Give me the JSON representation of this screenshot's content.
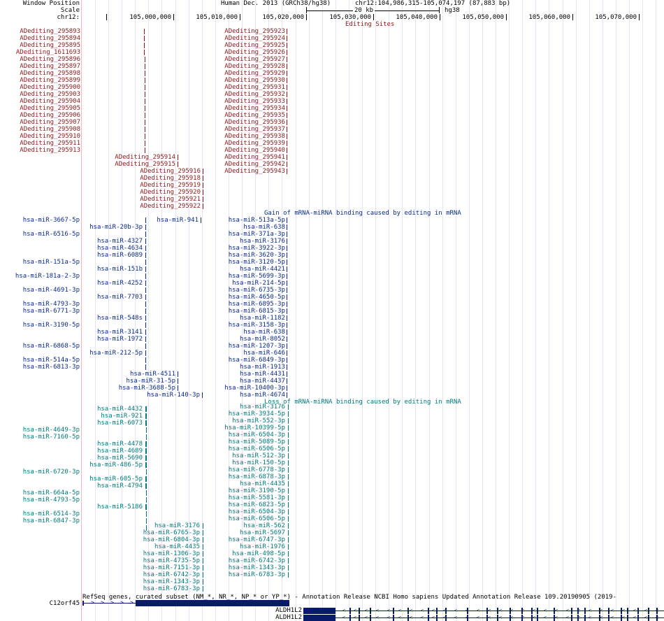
{
  "header": {
    "window_position_label": "Window Position",
    "scale_label": "Scale",
    "chrom_label": "chr12:",
    "assembly": "Human Dec. 2013 (GRCh38/hg38)",
    "position": "chr12:104,986,315-105,074,197 (87,883 bp)",
    "scale_text": "20 kb",
    "scale_db": "hg38",
    "ruler_ticks": [
      "105,000,000",
      "105,010,000",
      "105,020,000",
      "105,030,000",
      "105,040,000",
      "105,050,000",
      "105,060,000",
      "105,070,000"
    ]
  },
  "editing_sites": {
    "track_title": "Editing Sites",
    "left_labels": [
      "ADediting_295893",
      "ADediting_295894",
      "ADediting_295895",
      "ADediting_1611693",
      "ADediting_295896",
      "ADediting_295897",
      "ADediting_295898",
      "ADediting_295899",
      "ADediting_295900",
      "ADediting_295903",
      "ADediting_295904",
      "ADediting_295905",
      "ADediting_295906",
      "ADediting_295907",
      "ADediting_295908",
      "ADediting_295910",
      "ADediting_295911",
      "ADediting_295913"
    ],
    "mid_labels": [
      "ADediting_295914",
      "ADediting_295915",
      "ADediting_295916",
      "ADediting_295918",
      "ADediting_295919",
      "ADediting_295920",
      "ADediting_295921",
      "ADediting_295922"
    ],
    "right_labels": [
      "ADediting_295923",
      "ADediting_295924",
      "ADediting_295925",
      "ADediting_295926",
      "ADediting_295927",
      "ADediting_295928",
      "ADediting_295929",
      "ADediting_295930",
      "ADediting_295931",
      "ADediting_295932",
      "ADediting_295933",
      "ADediting_295934",
      "ADediting_295935",
      "ADediting_295936",
      "ADediting_295937",
      "ADediting_295938",
      "ADediting_295939",
      "ADediting_295940",
      "ADediting_295941",
      "ADediting_295942",
      "ADediting_295943"
    ]
  },
  "gain_track": {
    "track_title": "Gain of mRNA-miRNA binding caused by editing in mRNA",
    "left_labels": [
      "hsa-miR-3667-5p",
      "",
      "hsa-miR-6516-5p",
      "",
      "",
      "",
      "hsa-miR-151a-5p",
      "",
      "hsa-miR-181a-2-3p",
      "",
      "hsa-miR-4691-3p",
      "",
      "hsa-miR-4793-3p",
      "hsa-miR-6771-3p",
      "",
      "hsa-miR-3190-5p",
      "",
      "",
      "hsa-miR-6868-5p",
      "",
      "hsa-miR-514a-5p",
      "hsa-miR-6813-3p"
    ],
    "mid_labels": [
      "hsa-miR-941",
      "hsa-miR-20b-3p",
      "",
      "hsa-miR-4327",
      "hsa-miR-4634",
      "hsa-miR-6089",
      "",
      "hsa-miR-151b",
      "",
      "hsa-miR-4252",
      "",
      "hsa-miR-7703",
      "",
      "",
      "hsa-miR-548s",
      "",
      "hsa-miR-3141",
      "hsa-miR-1972",
      "",
      "hsa-miR-212-5p",
      "",
      "",
      "hsa-miR-4511",
      "hsa-miR-31-5p",
      "hsa-miR-3688-5p",
      "hsa-miR-140-3p"
    ],
    "right_labels": [
      "hsa-miR-513a-5p",
      "hsa-miR-638",
      "hsa-miR-371a-3p",
      "hsa-miR-3176",
      "hsa-miR-3922-3p",
      "hsa-miR-3620-3p",
      "hsa-miR-3120-5p",
      "hsa-miR-4421",
      "hsa-miR-5699-3p",
      "hsa-miR-214-5p",
      "hsa-miR-6735-3p",
      "hsa-miR-4650-5p",
      "hsa-miR-6895-3p",
      "hsa-miR-6815-3p",
      "hsa-miR-1182",
      "hsa-miR-3158-3p",
      "hsa-miR-638",
      "hsa-miR-8052",
      "hsa-miR-1207-3p",
      "hsa-miR-646",
      "hsa-miR-6849-3p",
      "hsa-miR-1913",
      "hsa-miR-4431",
      "hsa-miR-4437",
      "hsa-miR-10400-3p",
      "hsa-miR-4674"
    ]
  },
  "loss_track": {
    "track_title": "Loss of mRNA-miRNA binding caused by editing in mRNA",
    "left_labels": [
      "",
      "",
      "",
      "hsa-miR-4649-3p",
      "hsa-miR-7160-5p",
      "",
      "",
      "",
      "",
      "hsa-miR-6720-3p",
      "",
      "",
      "hsa-miR-664a-5p",
      "hsa-miR-4793-5p",
      "",
      "hsa-miR-6514-3p",
      "hsa-miR-6847-3p"
    ],
    "mid_labels": [
      "hsa-miR-4432",
      "hsa-miR-921",
      "hsa-miR-6073",
      "",
      "",
      "hsa-miR-4478",
      "hsa-miR-4689",
      "hsa-miR-5690",
      "hsa-miR-486-5p",
      "",
      "hsa-miR-605-5p",
      "hsa-miR-4794",
      "",
      "",
      "hsa-miR-5186"
    ],
    "bottom_mid_labels": [
      "hsa-miR-3176",
      "hsa-miR-6765-3p",
      "hsa-miR-6804-3p",
      "hsa-miR-4435",
      "hsa-miR-1306-3p",
      "hsa-miR-4735-5p",
      "hsa-miR-7151-3p",
      "hsa-miR-6742-3p",
      "hsa-miR-1343-3p",
      "hsa-miR-6783-3p"
    ],
    "right_labels": [
      "hsa-miR-3176",
      "hsa-miR-3934-5p",
      "hsa-miR-552-3p",
      "hsa-miR-10399-5p",
      "hsa-miR-6504-3p",
      "hsa-miR-5089-5p",
      "hsa-miR-6506-5p",
      "hsa-miR-512-3p",
      "hsa-miR-150-5p",
      "hsa-miR-6778-3p",
      "hsa-miR-6878-3p",
      "hsa-miR-4435",
      "hsa-miR-3190-5p",
      "hsa-miR-5581-3p",
      "hsa-miR-6823-5p",
      "hsa-miR-6504-3p",
      "hsa-miR-6506-5p",
      "hsa-miR-562",
      "hsa-miR-5697",
      "hsa-miR-6747-3p",
      "hsa-miR-1976",
      "hsa-miR-498-5p",
      "hsa-miR-6742-3p",
      "hsa-miR-1343-3p",
      "hsa-miR-6783-3p"
    ]
  },
  "genes_track": {
    "track_title": "RefSeq genes, curated subset (NM_*, NR_*, NP_* or YP_*) - Annotation Release NCBI Homo sapiens Updated Annotation Release 109.20190905 (2019-",
    "genes": [
      "C12orf45",
      "ALDH1L2",
      "ALDH1L2"
    ]
  },
  "colors": {
    "editing": "#8b1a1a",
    "gain": "#0a2a8a",
    "loss": "#007a7a",
    "gene": "#0a1a6a"
  }
}
